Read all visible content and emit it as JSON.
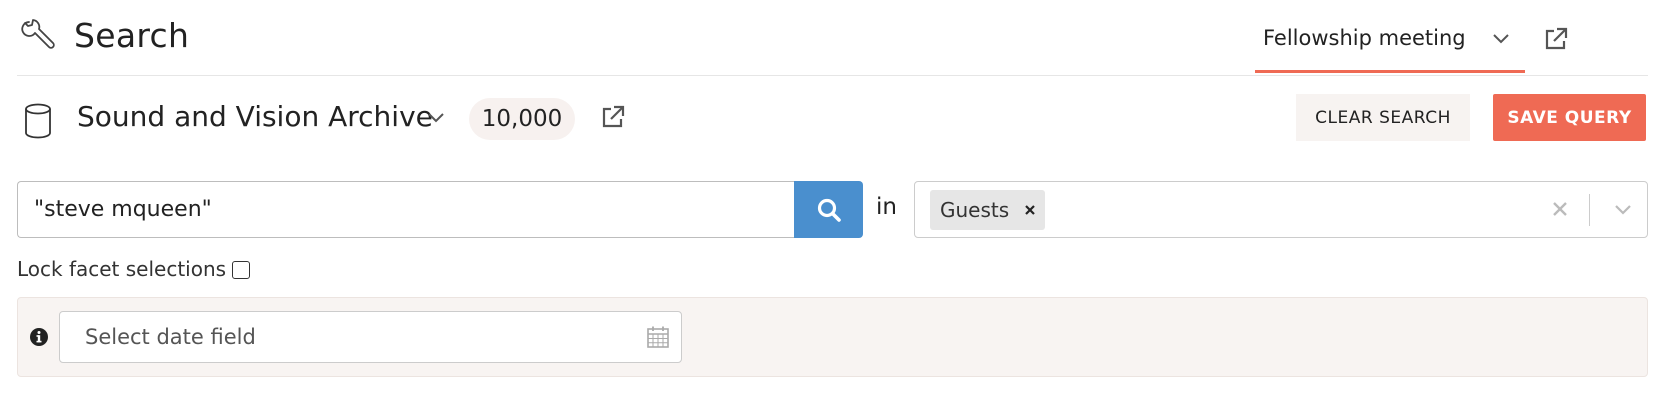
{
  "header": {
    "icon": "wrench-icon",
    "title": "Search",
    "active_tab": "Fellowship meeting",
    "tab_accent_color": "#ef6a54"
  },
  "collection": {
    "icon": "database-icon",
    "name": "Sound and Vision Archive",
    "count": "10,000"
  },
  "actions": {
    "clear_label": "CLEAR SEARCH",
    "save_label": "SAVE QUERY",
    "save_color": "#ef6a54"
  },
  "search": {
    "query": "\"steve mqueen\"",
    "button_color": "#4a8fce",
    "in_label": "in",
    "fields": [
      {
        "label": "Guests"
      }
    ]
  },
  "facets": {
    "lock_label": "Lock facet selections",
    "lock_checked": false
  },
  "date": {
    "placeholder": "Select date field"
  }
}
